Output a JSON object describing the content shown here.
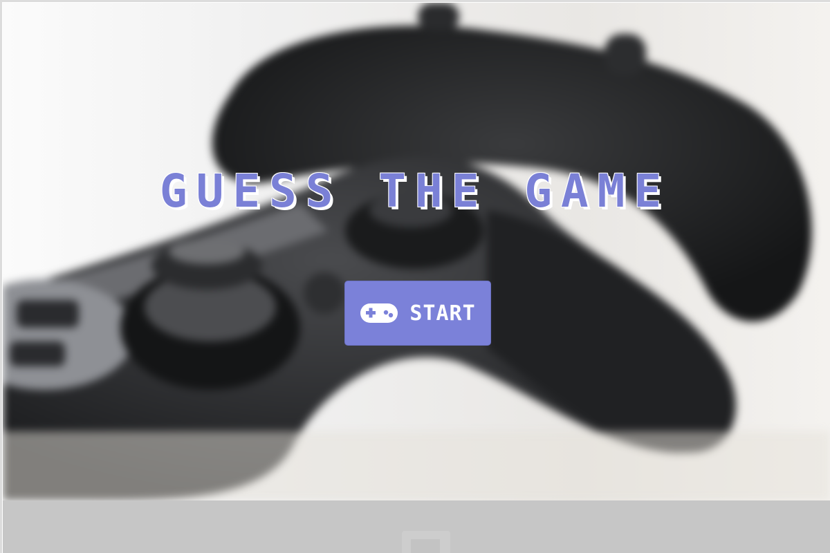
{
  "title": "GUESS THE GAME",
  "start_button": {
    "label": "START",
    "icon": "gamepad-icon"
  },
  "colors": {
    "accent": "#7b81d9",
    "title": "#7a80d6",
    "controller_dark": "#1f2021",
    "bottom_bar": "#c6c6c6"
  },
  "background": {
    "depiction": "two-game-controllers-photo"
  }
}
